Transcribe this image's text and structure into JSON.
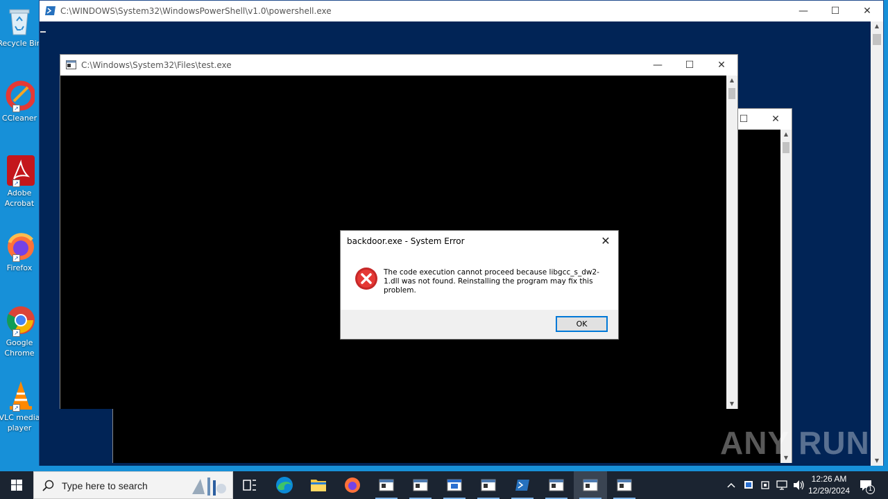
{
  "desktop": {
    "icons": [
      {
        "label": "Recycle Bin"
      },
      {
        "label": "CCleaner"
      },
      {
        "label": "Adobe Acrobat"
      },
      {
        "label": "Firefox"
      },
      {
        "label": "Google Chrome"
      },
      {
        "label": "VLC media player"
      }
    ]
  },
  "windows": {
    "powershell": {
      "title": "C:\\WINDOWS\\System32\\WindowsPowerShell\\v1.0\\powershell.exe"
    },
    "test": {
      "title": "C:\\Windows\\System32\\Files\\test.exe"
    }
  },
  "dialog": {
    "title": "backdoor.exe - System Error",
    "message": "The code execution cannot proceed because libgcc_s_dw2-1.dll was not found. Reinstalling the program may fix this problem.",
    "ok_label": "OK"
  },
  "watermark": {
    "text": "ANY RUN"
  },
  "taskbar": {
    "search_placeholder": "Type here to search",
    "time": "12:26 AM",
    "date": "12/29/2024",
    "notification_count": "1"
  },
  "colors": {
    "desktop": "#1790d8",
    "powershell_bg": "#012456",
    "taskbar": "#1b2431",
    "error_red": "#d32f2f"
  }
}
